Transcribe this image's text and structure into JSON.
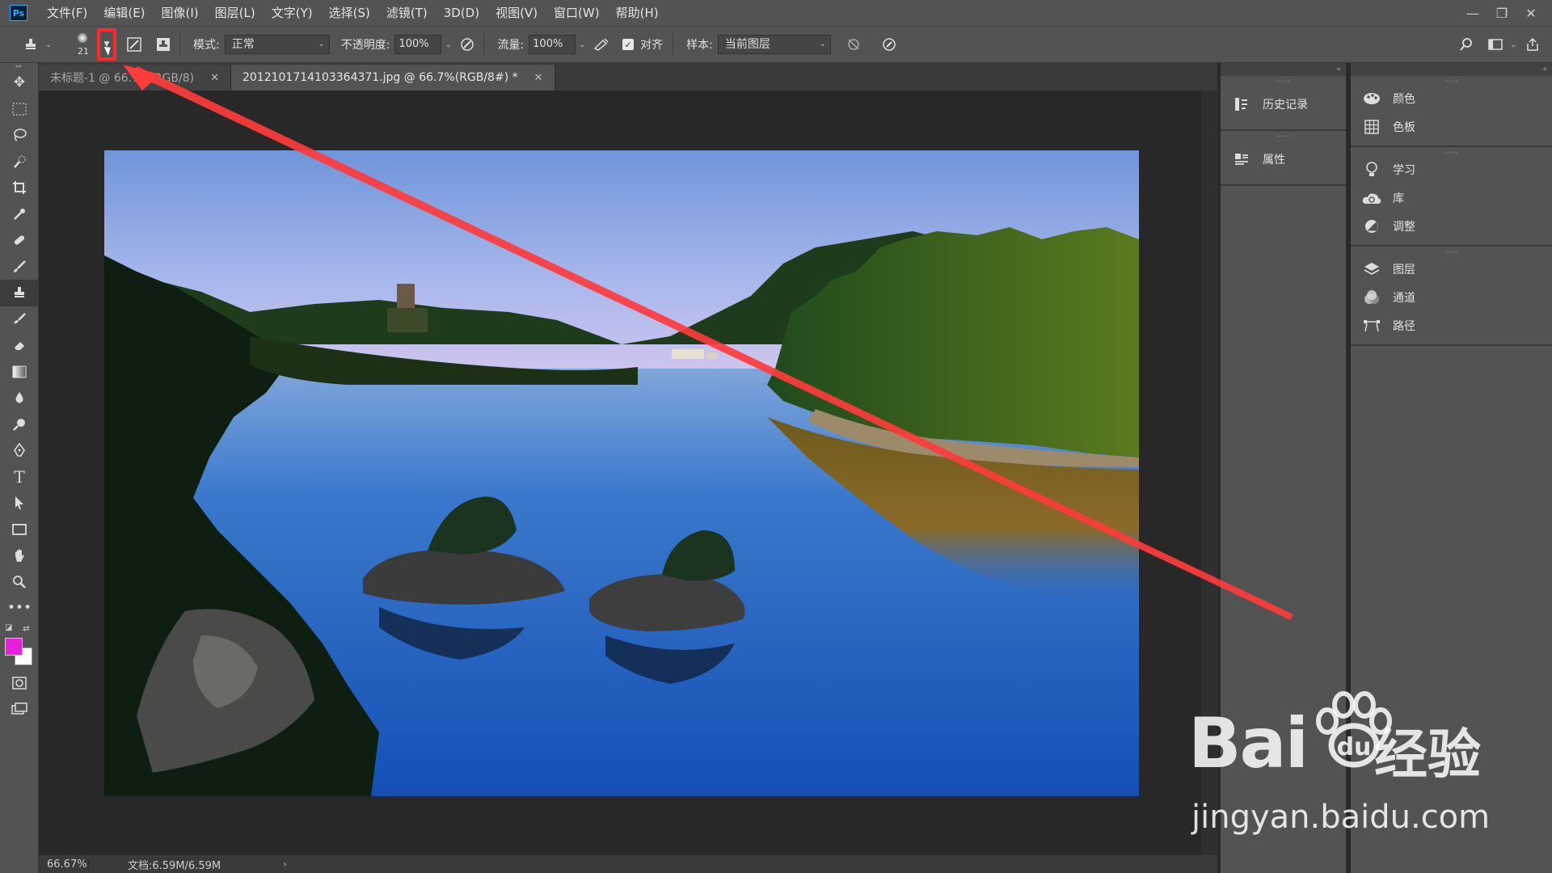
{
  "app": {
    "logo": "Ps",
    "menus": [
      "文件(F)",
      "编辑(E)",
      "图像(I)",
      "图层(L)",
      "文字(Y)",
      "选择(S)",
      "滤镜(T)",
      "3D(D)",
      "视图(V)",
      "窗口(W)",
      "帮助(H)"
    ],
    "window_controls": {
      "minimize": "—",
      "restore": "❐",
      "close": "✕"
    }
  },
  "options": {
    "brush_size": "21",
    "mode_label": "模式:",
    "mode_value": "正常",
    "opacity_label": "不透明度:",
    "opacity_value": "100%",
    "flow_label": "流量:",
    "flow_value": "100%",
    "align_label": "对齐",
    "align_checked": true,
    "sample_label": "样本:",
    "sample_value": "当前图层"
  },
  "tabs": [
    {
      "title": "未标题-1 @ 66.7%(RGB/8)",
      "active": false
    },
    {
      "title": "201210171410336437​1.jpg @ 66.7%(RGB/8#) *",
      "active": true
    }
  ],
  "status": {
    "zoom": "66.67%",
    "doc_info": "文档:6.59M/6.59M",
    "arrow": "›"
  },
  "colors": {
    "foreground": "#e61fd8",
    "background": "#ffffff",
    "annotation": "#ff3b3b"
  },
  "panels": {
    "col1": [
      [
        {
          "label": "历史记录",
          "icon": "history-icon"
        }
      ],
      [
        {
          "label": "属性",
          "icon": "properties-icon"
        }
      ]
    ],
    "col2": [
      [
        {
          "label": "颜色",
          "icon": "color-icon"
        },
        {
          "label": "色板",
          "icon": "swatches-icon"
        }
      ],
      [
        {
          "label": "学习",
          "icon": "learn-icon"
        },
        {
          "label": "库",
          "icon": "libraries-icon"
        },
        {
          "label": "调整",
          "icon": "adjustments-icon"
        }
      ],
      [
        {
          "label": "图层",
          "icon": "layers-icon"
        },
        {
          "label": "通道",
          "icon": "channels-icon"
        },
        {
          "label": "路径",
          "icon": "paths-icon"
        }
      ]
    ]
  },
  "watermark": {
    "brand": "Bai",
    "brand_cn": "经验",
    "url": "jingyan.baidu.com"
  }
}
